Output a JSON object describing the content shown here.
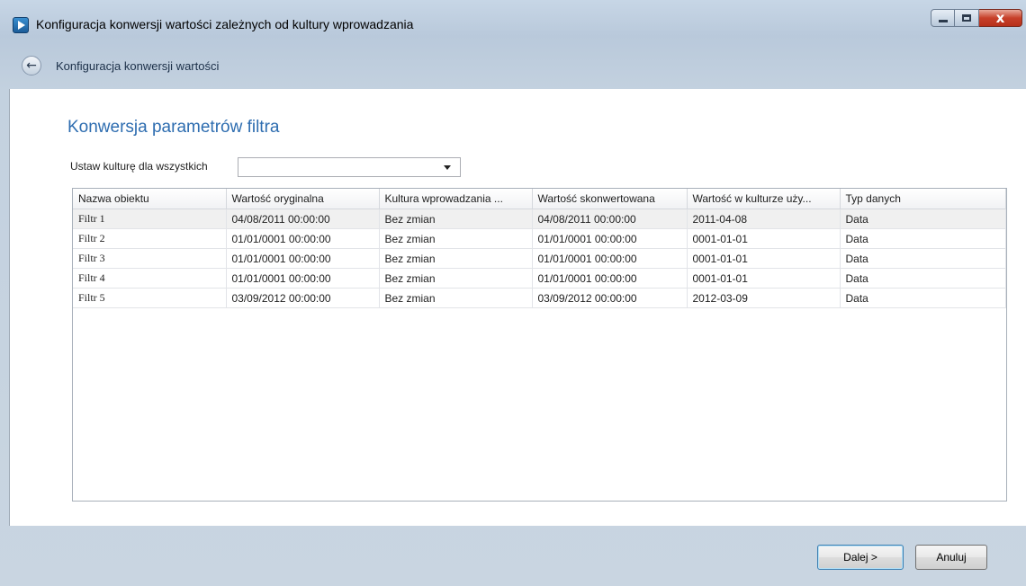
{
  "window": {
    "title": "Konfiguracja konwersji wartości zależnych od kultury wprowadzania",
    "close_glyph": "x"
  },
  "nav": {
    "back_icon": "←",
    "title": "Konfiguracja konwersji wartości"
  },
  "page": {
    "section_title": "Konwersja parametrów filtra",
    "culture_label": "Ustaw kulturę dla wszystkich",
    "culture_value": ""
  },
  "table": {
    "columns": [
      "Nazwa obiektu",
      "Wartość oryginalna",
      "Kultura wprowadzania ...",
      "Wartość skonwertowana",
      "Wartość w kulturze uży...",
      "Typ danych"
    ],
    "rows": [
      [
        "Filtr 1",
        "04/08/2011 00:00:00",
        "Bez zmian",
        "04/08/2011 00:00:00",
        "2011-04-08",
        "Data"
      ],
      [
        "Filtr 2",
        "01/01/0001 00:00:00",
        "Bez zmian",
        "01/01/0001 00:00:00",
        "0001-01-01",
        "Data"
      ],
      [
        "Filtr 3",
        "01/01/0001 00:00:00",
        "Bez zmian",
        "01/01/0001 00:00:00",
        "0001-01-01",
        "Data"
      ],
      [
        "Filtr 4",
        "01/01/0001 00:00:00",
        "Bez zmian",
        "01/01/0001 00:00:00",
        "0001-01-01",
        "Data"
      ],
      [
        "Filtr 5",
        "03/09/2012 00:00:00",
        "Bez zmian",
        "03/09/2012 00:00:00",
        "2012-03-09",
        "Data"
      ]
    ]
  },
  "footer": {
    "next_label": "Dalej >",
    "cancel_label": "Anuluj"
  },
  "colors": {
    "accent": "#2e6db0"
  }
}
